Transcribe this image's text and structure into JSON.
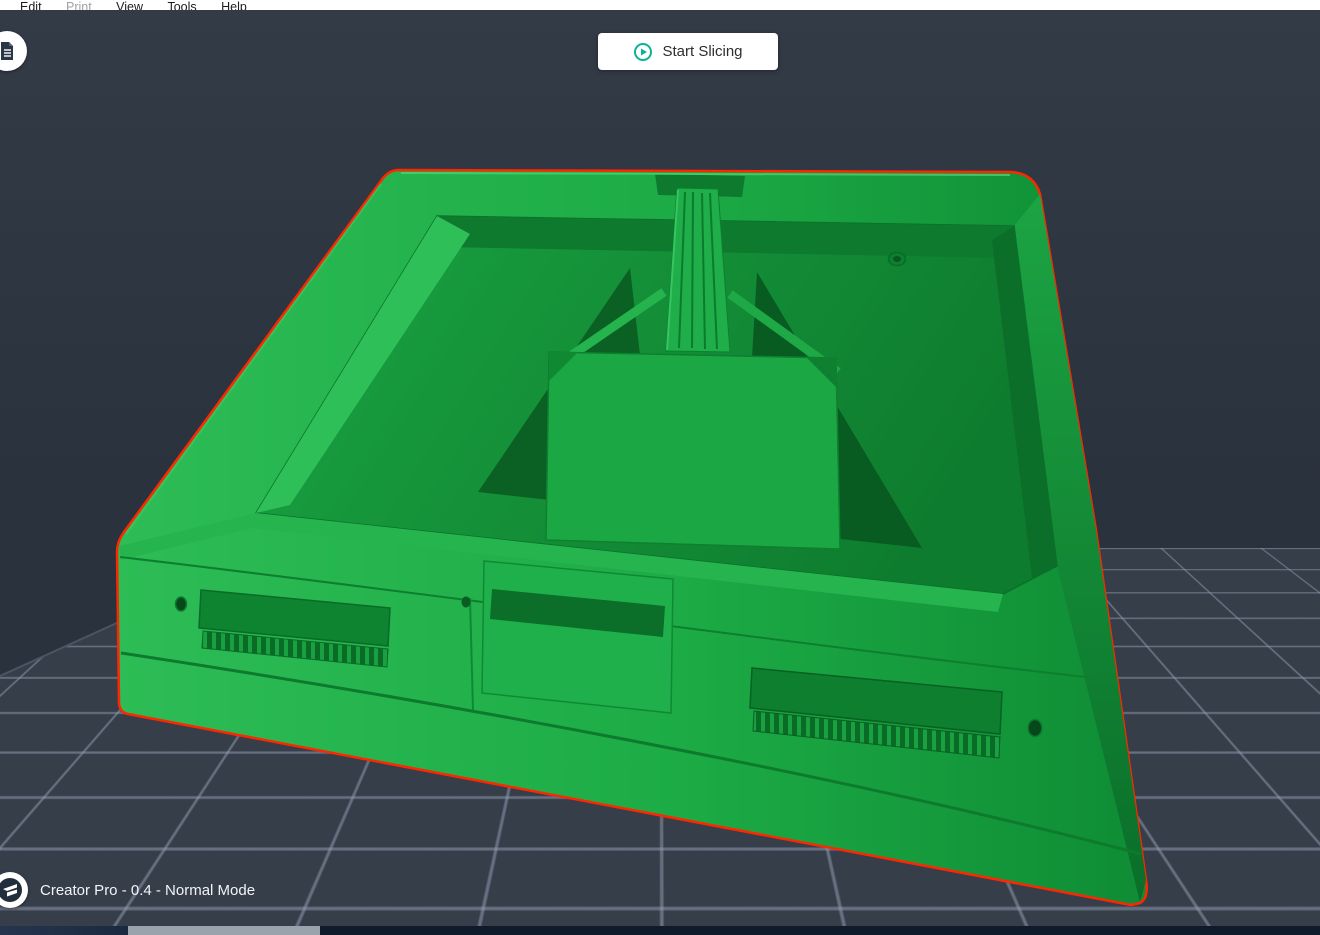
{
  "menu": {
    "items": [
      {
        "label": "Edit",
        "enabled": true
      },
      {
        "label": "Print",
        "enabled": false
      },
      {
        "label": "View",
        "enabled": true
      },
      {
        "label": "Tools",
        "enabled": true
      },
      {
        "label": "Help",
        "enabled": true
      }
    ]
  },
  "toolbar": {
    "start_slicing_label": "Start Slicing",
    "play_icon_color": "#0cb295"
  },
  "status_bar": {
    "text": "Creator Pro - 0.4 - Normal Mode"
  },
  "scene": {
    "model_color": "#22b24c",
    "selection_outline_color": "#ff2600",
    "bed_background": "#363e4a",
    "grid_line_color": "#96a0b4",
    "wall_background": "#2b333f"
  }
}
